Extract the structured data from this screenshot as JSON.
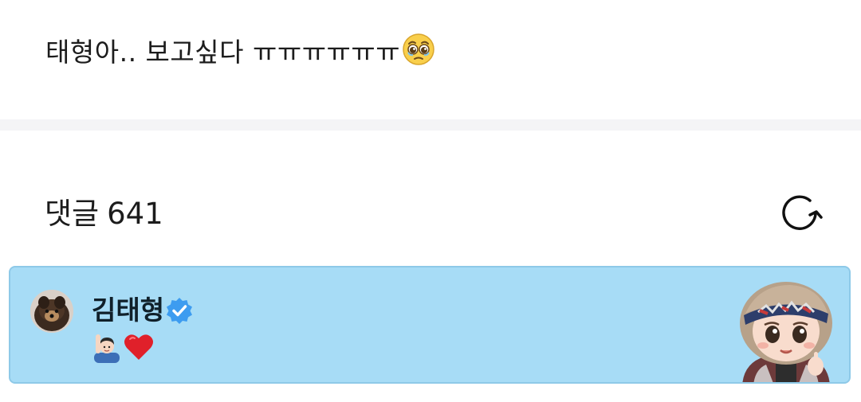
{
  "post": {
    "text": "태형아.. 보고싶다 ㅠㅠㅠㅠㅠㅠ",
    "emoji_icon": "pleading-face-emoji"
  },
  "comments": {
    "label": "댓글",
    "count": "641",
    "refresh_icon": "refresh-icon"
  },
  "comment": {
    "author": "김태형",
    "verified_icon": "verified-badge-icon",
    "emoji_icons": [
      "person-raising-hand-emoji",
      "red-heart-emoji"
    ],
    "sticker_icon": "tata-character-sticker"
  },
  "colors": {
    "card_background": "#a7dcf6",
    "card_border": "#8ec9e8",
    "verified_blue": "#3d9cf0",
    "divider": "#f4f4f6"
  }
}
